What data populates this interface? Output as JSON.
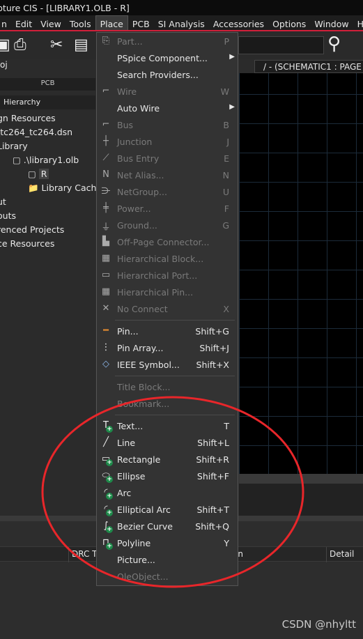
{
  "window": {
    "title": "pture CIS - [LIBRARY1.OLB - R]"
  },
  "menubar": [
    "n",
    "Edit",
    "View",
    "Tools",
    "Place",
    "PCB",
    "SI Analysis",
    "Accessories",
    "Options",
    "Window",
    "He"
  ],
  "project": {
    "title": "oj",
    "pcb_tab": "PCB",
    "hierarchy_tab": "Hierarchy",
    "tree": [
      "gn Resources",
      "\\tc264_tc264.dsn",
      "Library",
      ".\\library1.olb",
      "R",
      "Library Cache",
      "ut",
      "outs",
      "renced Projects",
      "ce Resources"
    ]
  },
  "document_tab": "/ - (SCHEMATIC1 : PAGE",
  "bottom_columns": [
    "DRC T",
    "on",
    "Detail"
  ],
  "place_menu": [
    {
      "label": "Part...",
      "shortcut": "P",
      "disabled": true,
      "icon": "part-icon"
    },
    {
      "label": "PSpice Component...",
      "submenu": true
    },
    {
      "label": "Search Providers..."
    },
    {
      "label": "Wire",
      "shortcut": "W",
      "disabled": true,
      "icon": "wire-icon"
    },
    {
      "label": "Auto Wire",
      "submenu": true
    },
    {
      "label": "Bus",
      "shortcut": "B",
      "disabled": true,
      "icon": "bus-icon"
    },
    {
      "label": "Junction",
      "shortcut": "J",
      "disabled": true,
      "icon": "junction-icon"
    },
    {
      "label": "Bus Entry",
      "shortcut": "E",
      "disabled": true,
      "icon": "bus-entry-icon"
    },
    {
      "label": "Net Alias...",
      "shortcut": "N",
      "disabled": true,
      "icon": "net-alias-icon"
    },
    {
      "label": "NetGroup...",
      "shortcut": "U",
      "disabled": true,
      "icon": "netgroup-icon"
    },
    {
      "label": "Power...",
      "shortcut": "F",
      "disabled": true,
      "icon": "power-icon"
    },
    {
      "label": "Ground...",
      "shortcut": "G",
      "disabled": true,
      "icon": "ground-icon"
    },
    {
      "label": "Off-Page Connector...",
      "disabled": true,
      "icon": "off-page-icon"
    },
    {
      "label": "Hierarchical Block...",
      "disabled": true,
      "icon": "hier-block-icon"
    },
    {
      "label": "Hierarchical Port...",
      "disabled": true,
      "icon": "hier-port-icon"
    },
    {
      "label": "Hierarchical Pin...",
      "disabled": true,
      "icon": "hier-pin-icon"
    },
    {
      "label": "No Connect",
      "shortcut": "X",
      "disabled": true,
      "icon": "no-connect-icon",
      "sep_after": true
    },
    {
      "label": "Pin...",
      "shortcut": "Shift+G",
      "icon": "pin-icon"
    },
    {
      "label": "Pin Array...",
      "shortcut": "Shift+J",
      "icon": "pin-array-icon"
    },
    {
      "label": "IEEE Symbol...",
      "shortcut": "Shift+X",
      "icon": "ieee-symbol-icon",
      "sep_after": true
    },
    {
      "label": "Title Block...",
      "disabled": true
    },
    {
      "label": "Bookmark...",
      "disabled": true,
      "sep_after": true
    },
    {
      "label": "Text...",
      "shortcut": "T",
      "icon": "text-icon"
    },
    {
      "label": "Line",
      "shortcut": "Shift+L",
      "icon": "line-icon"
    },
    {
      "label": "Rectangle",
      "shortcut": "Shift+R",
      "icon": "rectangle-icon"
    },
    {
      "label": "Ellipse",
      "shortcut": "Shift+F",
      "icon": "ellipse-icon"
    },
    {
      "label": "Arc",
      "icon": "arc-icon"
    },
    {
      "label": "Elliptical Arc",
      "shortcut": "Shift+T",
      "icon": "elliptical-arc-icon"
    },
    {
      "label": "Bezier Curve",
      "shortcut": "Shift+Q",
      "icon": "bezier-icon"
    },
    {
      "label": "Polyline",
      "shortcut": "Y",
      "icon": "polyline-icon"
    },
    {
      "label": "Picture..."
    },
    {
      "label": "OleObject...",
      "disabled": true
    }
  ],
  "watermark": "CSDN @nhyltt",
  "colors": {
    "accent": "#d0203a",
    "annotation": "#e8262a",
    "plus_badge": "#1e8a4a"
  }
}
